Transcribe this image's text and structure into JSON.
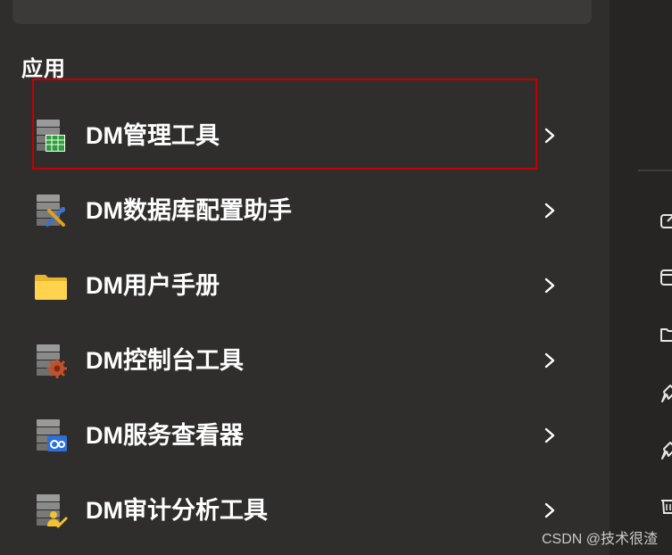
{
  "section": {
    "title": "应用"
  },
  "apps": [
    {
      "label": "DM管理工具",
      "icon": "database-table-icon"
    },
    {
      "label": "DM数据库配置助手",
      "icon": "database-tools-icon"
    },
    {
      "label": "DM用户手册",
      "icon": "folder-icon"
    },
    {
      "label": "DM控制台工具",
      "icon": "database-gear-icon"
    },
    {
      "label": "DM服务查看器",
      "icon": "database-service-icon"
    },
    {
      "label": "DM审计分析工具",
      "icon": "database-audit-icon"
    }
  ],
  "watermark": "CSDN @技术很渣",
  "colors": {
    "highlight": "#c40000",
    "background": "#2f2e2d"
  }
}
